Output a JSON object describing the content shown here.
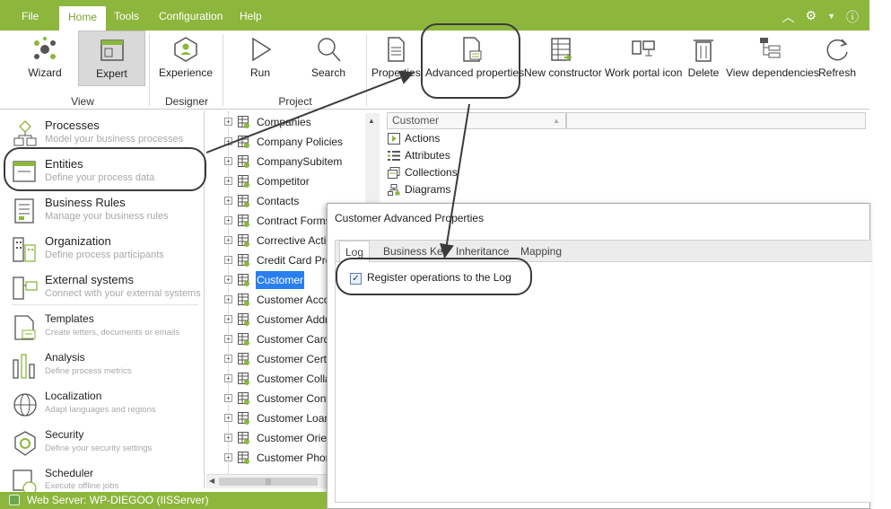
{
  "menu": {
    "items": [
      "File",
      "Home",
      "Tools",
      "Configuration",
      "Help"
    ],
    "active": "Home"
  },
  "ribbon": {
    "buttons": {
      "wizard": "Wizard",
      "expert": "Expert",
      "experience": "Experience",
      "run": "Run",
      "search": "Search",
      "properties": "Properties",
      "advanced_properties": "Advanced properties",
      "new_constructor": "New constructor",
      "work_portal_icon": "Work portal icon",
      "delete": "Delete",
      "view_dependencies": "View dependencies",
      "refresh": "Refresh"
    },
    "groups": {
      "view": "View",
      "designer": "Designer",
      "project": "Project"
    }
  },
  "nav": {
    "processes": {
      "title": "Processes",
      "sub": "Model your business processes"
    },
    "entities": {
      "title": "Entities",
      "sub": "Define your process data"
    },
    "business_rules": {
      "title": "Business Rules",
      "sub": "Manage your business rules"
    },
    "organization": {
      "title": "Organization",
      "sub": "Define process participants"
    },
    "external_systems": {
      "title": "External systems",
      "sub": "Connect with your external systems"
    },
    "templates": {
      "title": "Templates",
      "sub": "Create letters, documents or emails"
    },
    "analysis": {
      "title": "Analysis",
      "sub": "Define process metrics"
    },
    "localization": {
      "title": "Localization",
      "sub": "Adapt languages and regions"
    },
    "security": {
      "title": "Security",
      "sub": "Define your security settings"
    },
    "scheduler": {
      "title": "Scheduler",
      "sub": "Execute offline jobs"
    }
  },
  "tree": {
    "items": [
      "Companies",
      "Company Policies",
      "CompanySubitem",
      "Competitor",
      "Contacts",
      "Contract Forms",
      "Corrective Actic",
      "Credit Card Pro",
      "Customer",
      "Customer Acco",
      "Customer Addr",
      "Customer Card",
      "Customer Certi",
      "Customer Colla",
      "Customer Cont",
      "Customer Loan",
      "Customer Orier",
      "Customer Phon"
    ],
    "selected": "Customer"
  },
  "properties_panel": {
    "header": "Customer",
    "rows": [
      "Actions",
      "Attributes",
      "Collections",
      "Diagrams"
    ]
  },
  "dialog": {
    "title": "Customer Advanced Properties",
    "tabs": [
      "Log",
      "Business Key",
      "Inheritance",
      "Mapping"
    ],
    "active_tab": "Log",
    "checkbox_label": "Register operations to the Log",
    "checkbox_checked": true
  },
  "status": {
    "text": "Web Server: WP-DIEGOO (IISServer)"
  },
  "colors": {
    "brand_green": "#8cb63c",
    "selection_blue": "#2a7ff0"
  }
}
